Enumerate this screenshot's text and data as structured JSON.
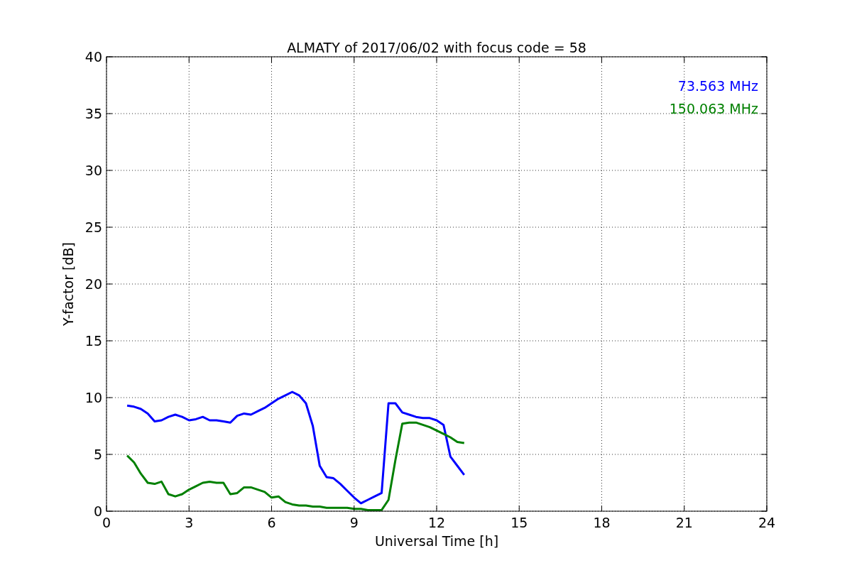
{
  "chart_data": {
    "type": "line",
    "title": "ALMATY of 2017/06/02 with focus code = 58",
    "xlabel": "Universal Time [h]",
    "ylabel": "Y-factor [dB]",
    "xlim": [
      0,
      24
    ],
    "ylim": [
      0,
      40
    ],
    "xticks": [
      0,
      3,
      6,
      9,
      12,
      15,
      18,
      21,
      24
    ],
    "yticks": [
      0,
      5,
      10,
      15,
      20,
      25,
      30,
      35,
      40
    ],
    "grid": true,
    "x": [
      0.75,
      1,
      1.25,
      1.5,
      1.75,
      2,
      2.25,
      2.5,
      2.75,
      3,
      3.25,
      3.5,
      3.75,
      4,
      4.25,
      4.5,
      4.75,
      5,
      5.25,
      5.5,
      5.75,
      6,
      6.25,
      6.5,
      6.75,
      7,
      7.25,
      7.5,
      7.75,
      8,
      8.25,
      8.5,
      8.75,
      9,
      9.25,
      9.5,
      9.75,
      10,
      10.25,
      10.5,
      10.75,
      11,
      11.25,
      11.5,
      11.75,
      12,
      12.25,
      12.5,
      12.75,
      13
    ],
    "series": [
      {
        "name": "73.563 MHz",
        "color": "#0000ff",
        "values": [
          9.3,
          9.2,
          9.0,
          8.6,
          7.9,
          8.0,
          8.3,
          8.5,
          8.3,
          8.0,
          8.1,
          8.3,
          8.0,
          8.0,
          7.9,
          7.8,
          8.4,
          8.6,
          8.5,
          8.8,
          9.1,
          9.5,
          9.9,
          10.2,
          10.5,
          10.2,
          9.5,
          7.5,
          4.0,
          3.0,
          2.9,
          2.4,
          1.8,
          1.2,
          0.7,
          1.0,
          1.3,
          1.6,
          9.5,
          9.5,
          8.7,
          8.5,
          8.3,
          8.2,
          8.2,
          8.0,
          7.6,
          4.8,
          4.0,
          3.2
        ]
      },
      {
        "name": "150.063 MHz",
        "color": "#008000",
        "values": [
          4.9,
          4.3,
          3.3,
          2.5,
          2.4,
          2.6,
          1.5,
          1.3,
          1.5,
          1.9,
          2.2,
          2.5,
          2.6,
          2.5,
          2.5,
          1.5,
          1.6,
          2.1,
          2.1,
          1.9,
          1.7,
          1.2,
          1.3,
          0.8,
          0.6,
          0.5,
          0.5,
          0.4,
          0.4,
          0.3,
          0.3,
          0.3,
          0.3,
          0.2,
          0.2,
          0.1,
          0.1,
          0.1,
          1.0,
          4.5,
          7.7,
          7.8,
          7.8,
          7.6,
          7.4,
          7.1,
          6.8,
          6.5,
          6.1,
          6.0
        ]
      }
    ]
  }
}
